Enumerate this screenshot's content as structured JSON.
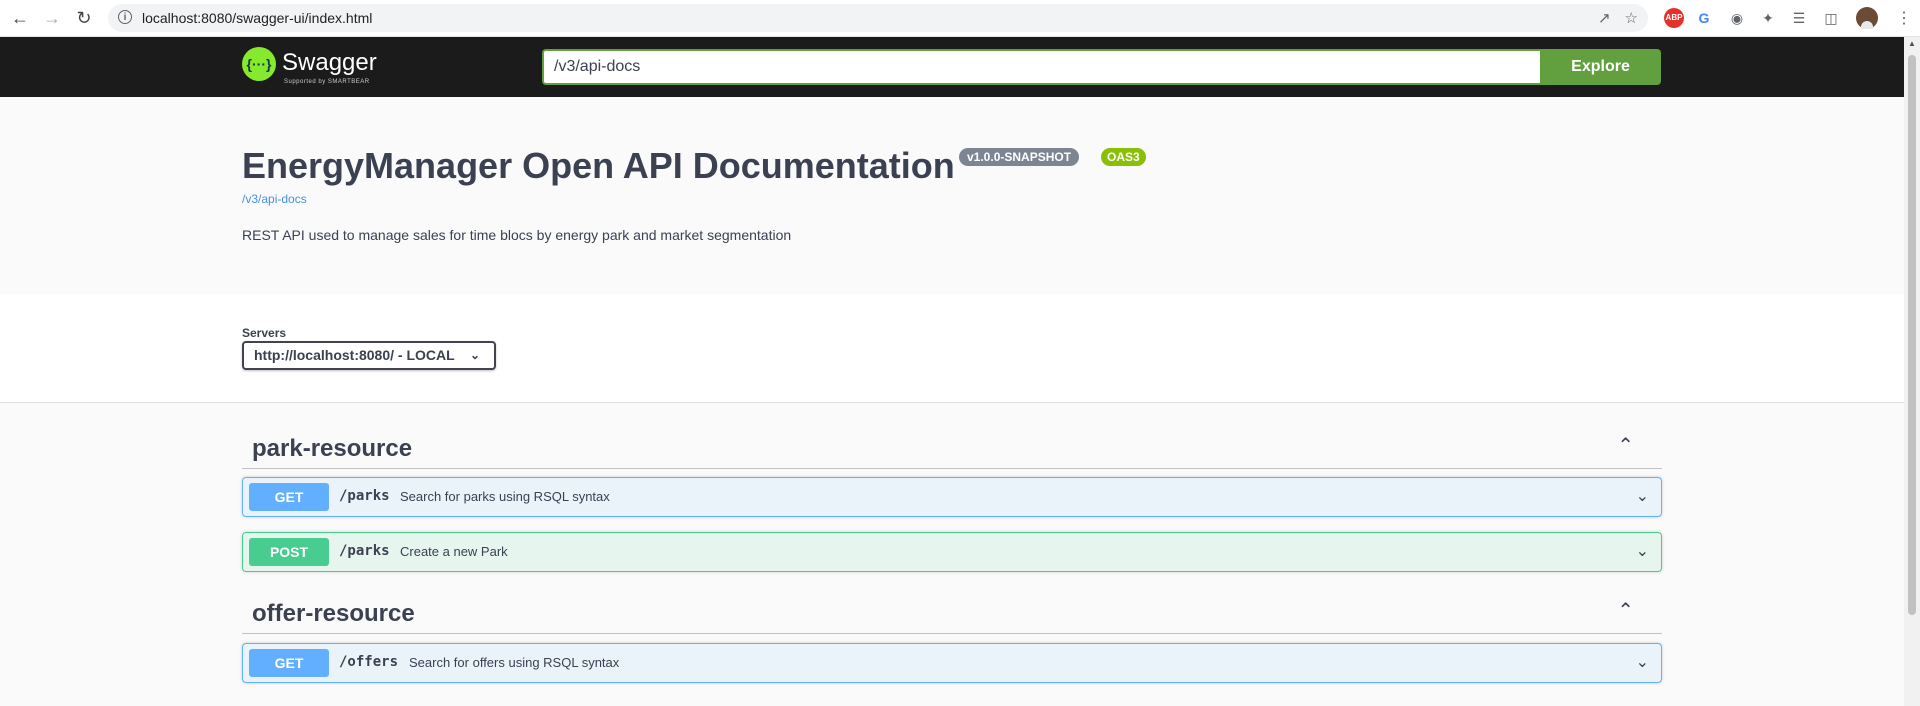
{
  "browser": {
    "url": "localhost:8080/swagger-ui/index.html",
    "back_icon": "arrow-left-icon",
    "forward_icon": "arrow-right-icon",
    "reload_icon": "reload-icon"
  },
  "topbar": {
    "brand": "Swagger",
    "brand_sub": "Supported by SMARTBEAR",
    "spec_url": "/v3/api-docs",
    "explore_label": "Explore"
  },
  "info": {
    "title": "EnergyManager Open API Documentation",
    "version": "v1.0.0-SNAPSHOT",
    "oas": "OAS3",
    "spec_link": "/v3/api-docs",
    "description": "REST API used to manage sales for time blocs by energy park and market segmentation"
  },
  "servers": {
    "label": "Servers",
    "selected": "http://localhost:8080/ - LOCAL"
  },
  "tags": [
    {
      "name": "park-resource",
      "operations": [
        {
          "method": "GET",
          "path": "/parks",
          "summary": "Search for parks using RSQL syntax"
        },
        {
          "method": "POST",
          "path": "/parks",
          "summary": "Create a new Park"
        }
      ]
    },
    {
      "name": "offer-resource",
      "operations": [
        {
          "method": "GET",
          "path": "/offers",
          "summary": "Search for offers using RSQL syntax"
        }
      ]
    }
  ],
  "colors": {
    "get": "#61affe",
    "post": "#49cc90",
    "explore": "#62a03f",
    "topbar": "#1b1b1b"
  }
}
